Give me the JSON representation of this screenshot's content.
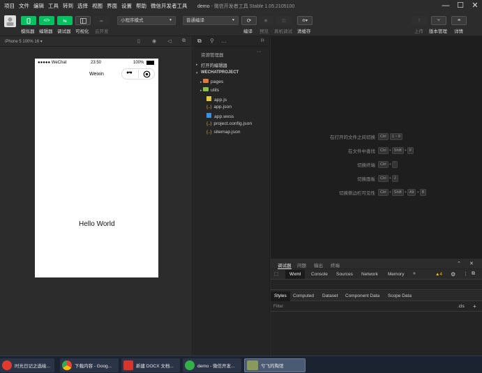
{
  "menubar": {
    "items": [
      "项目",
      "文件",
      "编辑",
      "工具",
      "转到",
      "选择",
      "视图",
      "界面",
      "设置",
      "帮助",
      "微信开发者工具"
    ],
    "title_project": "demo",
    "title_rest": " - 微信开发者工具 Stable 1.05.2105100"
  },
  "toolbar": {
    "simulator_label": "模拟器",
    "editor_label": "编辑器",
    "debugger_label": "调试器",
    "visual_label": "可视化",
    "cloud_label": "云开发",
    "mode_select": "小程序模式",
    "compile_select": "普通编译",
    "compile_label": "编译",
    "preview_label": "预览",
    "real_debug_label": "真机调试",
    "clear_cache_label": "清缓存",
    "upload_label": "上传",
    "version_label": "版本管理",
    "details_label": "详情",
    "accent": "#07c160"
  },
  "simulator": {
    "device_label": "iPhone 5 100% 16 ▾",
    "carrier": "●●●●● WeChat",
    "time": "23:50",
    "battery": "100%",
    "nav_title": "Weixin",
    "content_text": "Hello World"
  },
  "explorer": {
    "header": "资源管理器",
    "open_editors": "打开的编辑器",
    "project_name": "WECHATPROJECT",
    "folders": [
      "pages",
      "utils"
    ],
    "files": [
      "app.js",
      "app.json",
      "app.wxss",
      "project.config.json",
      "sitemap.json"
    ]
  },
  "editor_hints": [
    {
      "label": "在打开的文件之间切换",
      "keys": [
        "Ctrl",
        "1 ~ 8"
      ]
    },
    {
      "label": "在文件中查找",
      "keys": [
        "Ctrl",
        "Shift",
        "F"
      ]
    },
    {
      "label": "切换终端",
      "keys": [
        "Ctrl",
        "`"
      ]
    },
    {
      "label": "切换面板",
      "keys": [
        "Ctrl",
        "J"
      ]
    },
    {
      "label": "切换侧边栏可见性",
      "keys": [
        "Ctrl",
        "Shift",
        "Alt",
        "B"
      ]
    }
  ],
  "devtools": {
    "top_tabs": [
      "调试器",
      "问题",
      "输出",
      "终端"
    ],
    "panel_tabs": [
      "Wxml",
      "Console",
      "Sources",
      "Network",
      "Memory",
      "»"
    ],
    "warning_count": "▲4",
    "styles_tabs": [
      "Styles",
      "Computed",
      "Dataset",
      "Component Data",
      "Scope Data"
    ],
    "filter_placeholder": "Filter",
    "cls_label": ".cls",
    "plus_label": "+"
  },
  "taskbar": {
    "tasks": [
      {
        "label": "时光日记之选绘...",
        "color": "#e03a2f"
      },
      {
        "label": "下载内容 - Goog...",
        "color": "#4a8df0"
      },
      {
        "label": "新建 DOCX 文档...",
        "color": "#d9342b"
      },
      {
        "label": "demo - 微信开发...",
        "color": "#34b04a"
      },
      {
        "label": "兮飞的陶馆",
        "color": "#8a9a5b"
      }
    ]
  }
}
